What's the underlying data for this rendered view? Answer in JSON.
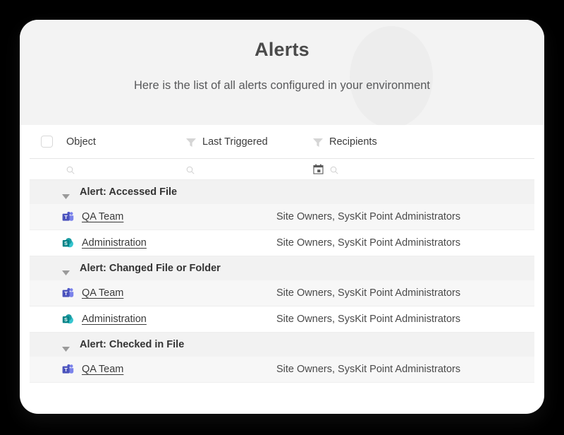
{
  "header": {
    "title": "Alerts",
    "subtitle": "Here is the list of all alerts configured in your environment"
  },
  "table": {
    "select_all_checkbox": "",
    "columns": [
      {
        "key": "object",
        "label": "Object",
        "has_filter": false
      },
      {
        "key": "last_triggered",
        "label": "Last Triggered",
        "has_filter": true
      },
      {
        "key": "recipients",
        "label": "Recipients",
        "has_filter": true
      }
    ],
    "filter_row": {
      "object_search_icon": "search-icon",
      "last_triggered_search_icon": "search-icon",
      "last_triggered_calendar_icon": "calendar-icon",
      "recipients_search_icon": "search-icon"
    },
    "groups": [
      {
        "title": "Alert: Accessed File",
        "expanded": true,
        "caret_icon": "chevron-down-icon",
        "rows": [
          {
            "icon": "microsoft-teams-icon",
            "object": "QA Team",
            "last_triggered": "",
            "recipients": "Site Owners, SysKit Point Administrators"
          },
          {
            "icon": "sharepoint-icon",
            "object": "Administration",
            "last_triggered": "",
            "recipients": "Site Owners, SysKit Point Administrators"
          }
        ]
      },
      {
        "title": "Alert: Changed File or Folder",
        "expanded": true,
        "caret_icon": "chevron-down-icon",
        "rows": [
          {
            "icon": "microsoft-teams-icon",
            "object": "QA Team",
            "last_triggered": "",
            "recipients": "Site Owners, SysKit Point Administrators"
          },
          {
            "icon": "sharepoint-icon",
            "object": "Administration",
            "last_triggered": "",
            "recipients": "Site Owners, SysKit Point Administrators"
          }
        ]
      },
      {
        "title": "Alert: Checked in File",
        "expanded": true,
        "caret_icon": "chevron-down-icon",
        "rows": [
          {
            "icon": "microsoft-teams-icon",
            "object": "QA Team",
            "last_triggered": "",
            "recipients": "Site Owners, SysKit Point Administrators"
          }
        ]
      }
    ]
  },
  "colors": {
    "page_background": "#000000",
    "card_background": "#ffffff",
    "header_band": "#f3f3f3",
    "group_header": "#f2f2f2",
    "row_alt": "#f7f7f7",
    "title_text": "#4a4a4a",
    "teams_purple": "#5059c9",
    "sharepoint_teal": "#038387"
  }
}
